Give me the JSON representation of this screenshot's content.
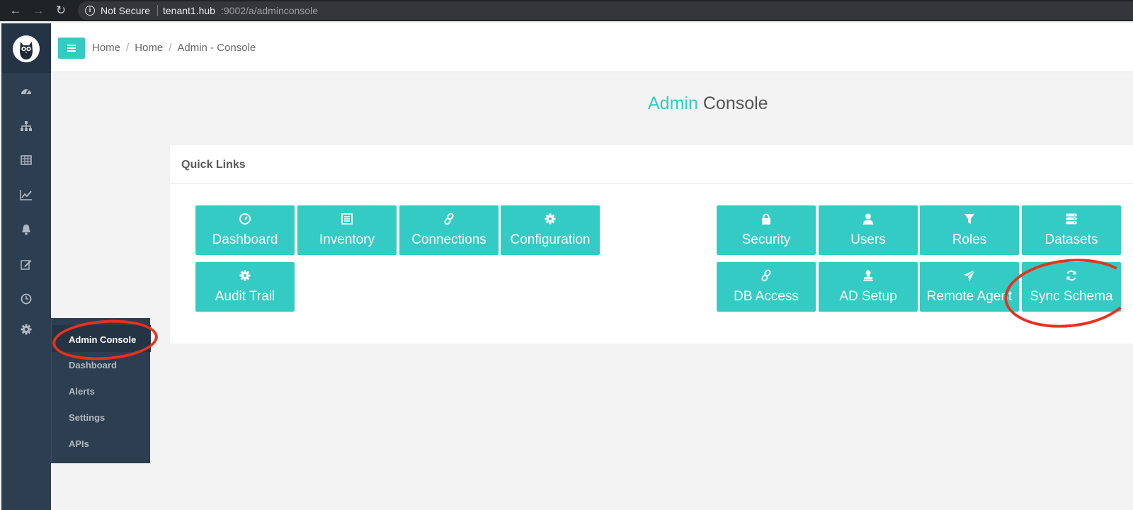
{
  "browser": {
    "warning": "Not Secure",
    "host": "tenant1.hub",
    "path": ":9002/a/adminconsole"
  },
  "sidebar": {
    "icons": [
      "dashboard-icon",
      "hierarchy-icon",
      "table-icon",
      "line-chart-icon",
      "bell-icon",
      "edit-icon",
      "clock-icon",
      "gear-icon"
    ]
  },
  "flyout": {
    "items": [
      {
        "label": "Admin Console",
        "active": true
      },
      {
        "label": "Dashboard"
      },
      {
        "label": "Alerts"
      },
      {
        "label": "Settings"
      },
      {
        "label": "APIs"
      }
    ]
  },
  "breadcrumb": [
    "Home",
    "Home",
    "Admin - Console"
  ],
  "title": {
    "accent": "Admin",
    "rest": "Console"
  },
  "quick_links": {
    "title": "Quick Links",
    "left": [
      {
        "label": "Dashboard",
        "icon": "gauge-icon"
      },
      {
        "label": "Inventory",
        "icon": "list-icon"
      },
      {
        "label": "Connections",
        "icon": "link-icon"
      },
      {
        "label": "Configuration",
        "icon": "cog-icon"
      },
      {
        "label": "Audit Trail",
        "icon": "cog-icon"
      }
    ],
    "right": [
      {
        "label": "Security",
        "icon": "lock-icon"
      },
      {
        "label": "Users",
        "icon": "user-icon"
      },
      {
        "label": "Roles",
        "icon": "filter-icon"
      },
      {
        "label": "Datasets",
        "icon": "server-icon"
      },
      {
        "label": "DB Access",
        "icon": "link-icon"
      },
      {
        "label": "AD Setup",
        "icon": "stamp-icon"
      },
      {
        "label": "Remote Agent",
        "icon": "paper-plane-icon"
      },
      {
        "label": "Sync Schema",
        "icon": "refresh-icon"
      }
    ]
  },
  "colors": {
    "accent": "#34cbc5",
    "sidebar": "#2c3e50",
    "annotation": "#e8311e"
  }
}
